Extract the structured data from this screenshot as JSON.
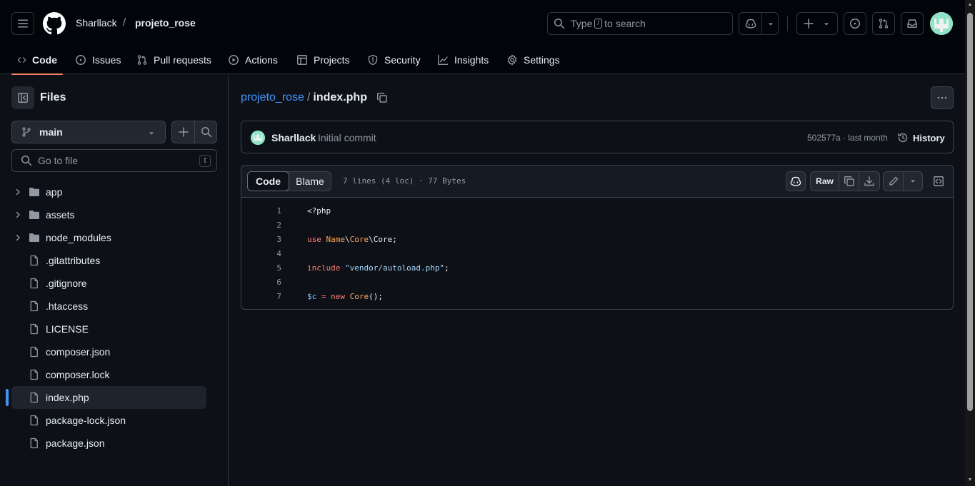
{
  "header": {
    "owner": "Sharllack",
    "separator": "/",
    "repo": "projeto_rose",
    "search": {
      "prefix": "Type",
      "key": "/",
      "suffix": "to search"
    }
  },
  "repo_nav": {
    "tabs": [
      {
        "label": "Code",
        "icon": "code-icon",
        "active": true
      },
      {
        "label": "Issues",
        "icon": "issue-opened-icon"
      },
      {
        "label": "Pull requests",
        "icon": "git-pull-request-icon"
      },
      {
        "label": "Actions",
        "icon": "play-icon"
      },
      {
        "label": "Projects",
        "icon": "table-icon"
      },
      {
        "label": "Security",
        "icon": "shield-icon"
      },
      {
        "label": "Insights",
        "icon": "graph-icon"
      },
      {
        "label": "Settings",
        "icon": "gear-icon"
      }
    ]
  },
  "sidebar": {
    "title": "Files",
    "branch": "main",
    "goto_placeholder": "Go to file",
    "goto_key": "t",
    "items": [
      {
        "name": "app",
        "type": "folder"
      },
      {
        "name": "assets",
        "type": "folder"
      },
      {
        "name": "node_modules",
        "type": "folder"
      },
      {
        "name": ".gitattributes",
        "type": "file"
      },
      {
        "name": ".gitignore",
        "type": "file"
      },
      {
        "name": ".htaccess",
        "type": "file"
      },
      {
        "name": "LICENSE",
        "type": "file"
      },
      {
        "name": "composer.json",
        "type": "file"
      },
      {
        "name": "composer.lock",
        "type": "file"
      },
      {
        "name": "index.php",
        "type": "file",
        "selected": true
      },
      {
        "name": "package-lock.json",
        "type": "file"
      },
      {
        "name": "package.json",
        "type": "file"
      }
    ]
  },
  "main": {
    "path_repo": "projeto_rose",
    "path_sep": "/",
    "path_file": "index.php",
    "commit": {
      "author": "Sharllack",
      "message": "Initial commit",
      "meta": "502577a · last month",
      "history_label": "History"
    },
    "viewer": {
      "tab_code": "Code",
      "tab_blame": "Blame",
      "info": "7 lines (4 loc) · 77 Bytes",
      "raw_label": "Raw"
    },
    "code_lines": [
      {
        "n": "1",
        "text": "<?php"
      },
      {
        "n": "2",
        "text": ""
      },
      {
        "n": "3",
        "text": "use Name\\Core\\Core;"
      },
      {
        "n": "4",
        "text": ""
      },
      {
        "n": "5",
        "text": "include \"vendor/autoload.php\";"
      },
      {
        "n": "6",
        "text": ""
      },
      {
        "n": "7",
        "text": "$c = new Core();"
      }
    ]
  },
  "colors": {
    "accent_link": "#4493f8",
    "active_tab_underline": "#f78166",
    "avatar": "#8fe3c7"
  }
}
